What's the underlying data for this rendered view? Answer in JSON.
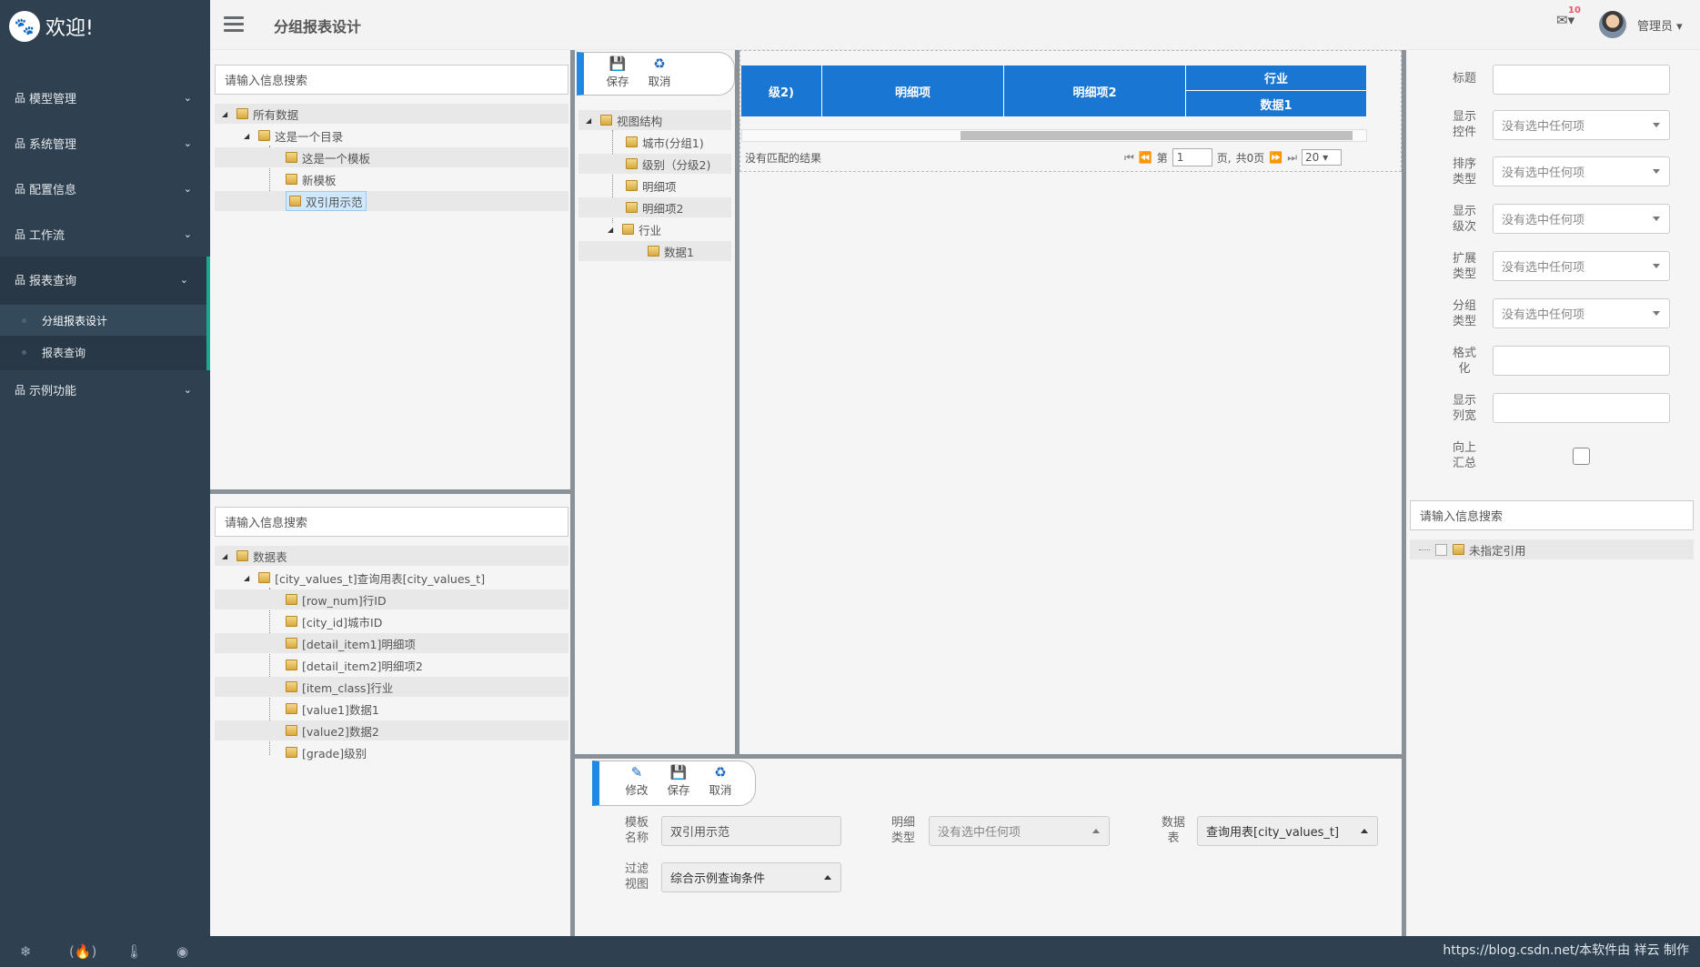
{
  "app": {
    "title": "欢迎!",
    "page_title": "分组报表设计",
    "user": "管理员",
    "mail_count": "10"
  },
  "sidebar": {
    "items": [
      {
        "label": "模型管理"
      },
      {
        "label": "系统管理"
      },
      {
        "label": "配置信息"
      },
      {
        "label": "工作流"
      },
      {
        "label": "报表查询"
      },
      {
        "label": "示例功能"
      }
    ],
    "subitems": [
      {
        "label": "分组报表设计"
      },
      {
        "label": "报表查询"
      }
    ]
  },
  "left_top": {
    "search_placeholder": "请输入信息搜索",
    "tree": [
      "所有数据",
      "这是一个目录",
      "这是一个模板",
      "新模板",
      "双引用示范"
    ]
  },
  "left_bottom": {
    "search_placeholder": "请输入信息搜索",
    "tree": [
      "数据表",
      "[city_values_t]查询用表[city_values_t]",
      "[row_num]行ID",
      "[city_id]城市ID",
      "[detail_item1]明细项",
      "[detail_item2]明细项2",
      "[item_class]行业",
      "[value1]数据1",
      "[value2]数据2",
      "[grade]级别"
    ]
  },
  "view_panel": {
    "toolbar": {
      "save": "保存",
      "cancel": "取消"
    },
    "tree": [
      "视图结构",
      "城市(分组1)",
      "级别（分级2)",
      "明细项",
      "明细项2",
      "行业",
      "数据1"
    ]
  },
  "grid": {
    "headers": {
      "col1": "级2)",
      "col2": "明细项",
      "col3": "明细项2",
      "group": "行业",
      "sub": "数据1"
    },
    "no_result": "没有匹配的结果",
    "pager": {
      "page_prefix": "第",
      "page_value": "1",
      "page_suffix": "页,",
      "total": "共0页",
      "page_size": "20"
    }
  },
  "props": {
    "fields": [
      {
        "label": "标题",
        "value": ""
      },
      {
        "label": "显示\n控件",
        "value": "没有选中任何项"
      },
      {
        "label": "排序\n类型",
        "value": "没有选中任何项"
      },
      {
        "label": "显示\n级次",
        "value": "没有选中任何项"
      },
      {
        "label": "扩展\n类型",
        "value": "没有选中任何项"
      },
      {
        "label": "分组\n类型",
        "value": "没有选中任何项"
      },
      {
        "label": "格式\n化",
        "value": ""
      },
      {
        "label": "显示\n列宽",
        "value": ""
      },
      {
        "label": "向上\n汇总",
        "value": ""
      }
    ],
    "search_placeholder": "请输入信息搜索",
    "ref_tree": [
      "未指定引用"
    ]
  },
  "bottom_form": {
    "toolbar": {
      "edit": "修改",
      "save": "保存",
      "cancel": "取消"
    },
    "template_name_label": "模板\n名称",
    "template_name": "双引用示范",
    "detail_type_label": "明细\n类型",
    "detail_type": "没有选中任何项",
    "datatable_label": "数据\n表",
    "datatable": "查询用表[city_values_t]",
    "filter_view_label": "过滤\n视图",
    "filter_view": "综合示例查询条件"
  },
  "footer": {
    "credit": "https://blog.csdn.net/本软件由 祥云 制作"
  },
  "icons": {
    "logo": "paw-icon",
    "menu": "sitemap-icon",
    "hamburger": "hamburger-icon",
    "mail": "envelope-icon",
    "bottom": [
      "snowflake-icon",
      "fire-icon",
      "thermometer-icon",
      "user-circle-icon"
    ]
  },
  "colors": {
    "sidebar": "#2f4050",
    "accent": "#19aa8d",
    "grid_header": "#1976d2",
    "toolbar_accent": "#1e88e5"
  }
}
